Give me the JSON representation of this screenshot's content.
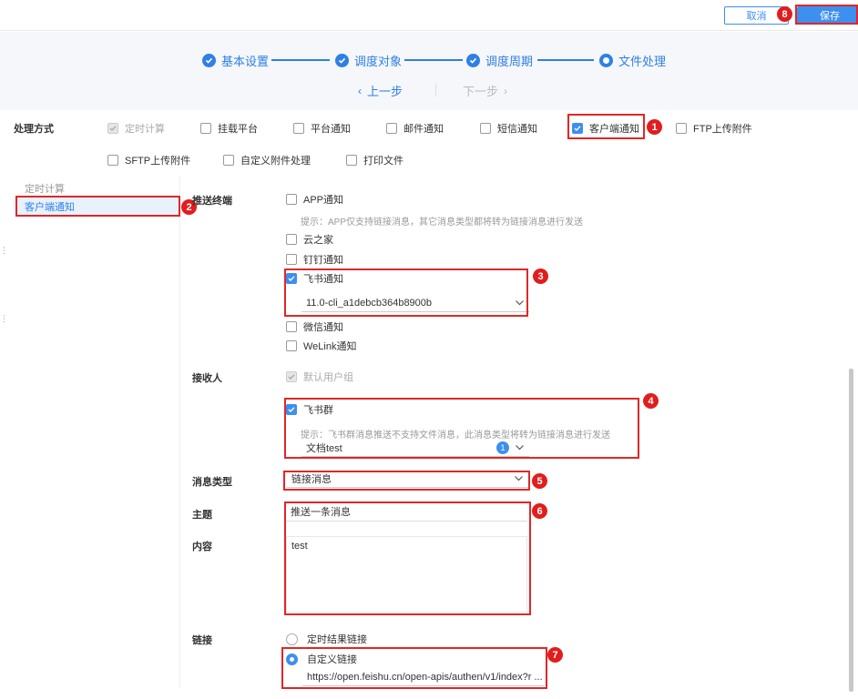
{
  "toolbar": {
    "cancel": "取消",
    "save": "保存"
  },
  "steps": [
    {
      "label": "基本设置"
    },
    {
      "label": "调度对象"
    },
    {
      "label": "调度周期"
    },
    {
      "label": "文件处理"
    }
  ],
  "nav": {
    "prev": "上一步",
    "next": "下一步"
  },
  "process": {
    "label": "处理方式",
    "options": [
      "定时计算",
      "挂载平台",
      "平台通知",
      "邮件通知",
      "短信通知",
      "客户端通知",
      "FTP上传附件",
      "SFTP上传附件",
      "自定义附件处理",
      "打印文件"
    ]
  },
  "left": {
    "items": [
      "定时计算",
      "客户端通知"
    ]
  },
  "push": {
    "label": "推送终端",
    "app": "APP通知",
    "app_hint": "提示：APP仅支持链接消息，其它消息类型都将转为链接消息进行发送",
    "yun": "云之家",
    "ding": "钉钉通知",
    "feishu": "飞书通知",
    "feishu_select": "11.0-cli_a1debcb364b8900b",
    "wechat": "微信通知",
    "welink": "WeLink通知"
  },
  "receiver": {
    "label": "接收人",
    "default": "默认用户组",
    "group": "飞书群",
    "group_hint": "提示：飞书群消息推送不支持文件消息，此消息类型将转为链接消息进行发送",
    "group_select": "文档test",
    "group_count": "1"
  },
  "msgtype": {
    "label": "消息类型",
    "value": "链接消息"
  },
  "subject": {
    "label": "主题",
    "value": "推送一条消息"
  },
  "content": {
    "label": "内容",
    "value": "test"
  },
  "link": {
    "label": "链接",
    "opt1": "定时结果链接",
    "opt2": "自定义链接",
    "url": "https://open.feishu.cn/open-apis/authen/v1/index?r ..."
  },
  "badges": [
    "1",
    "2",
    "3",
    "4",
    "5",
    "6",
    "7",
    "8"
  ],
  "colors": {
    "accent": "#3d8ff0",
    "highlight": "#e02727"
  }
}
